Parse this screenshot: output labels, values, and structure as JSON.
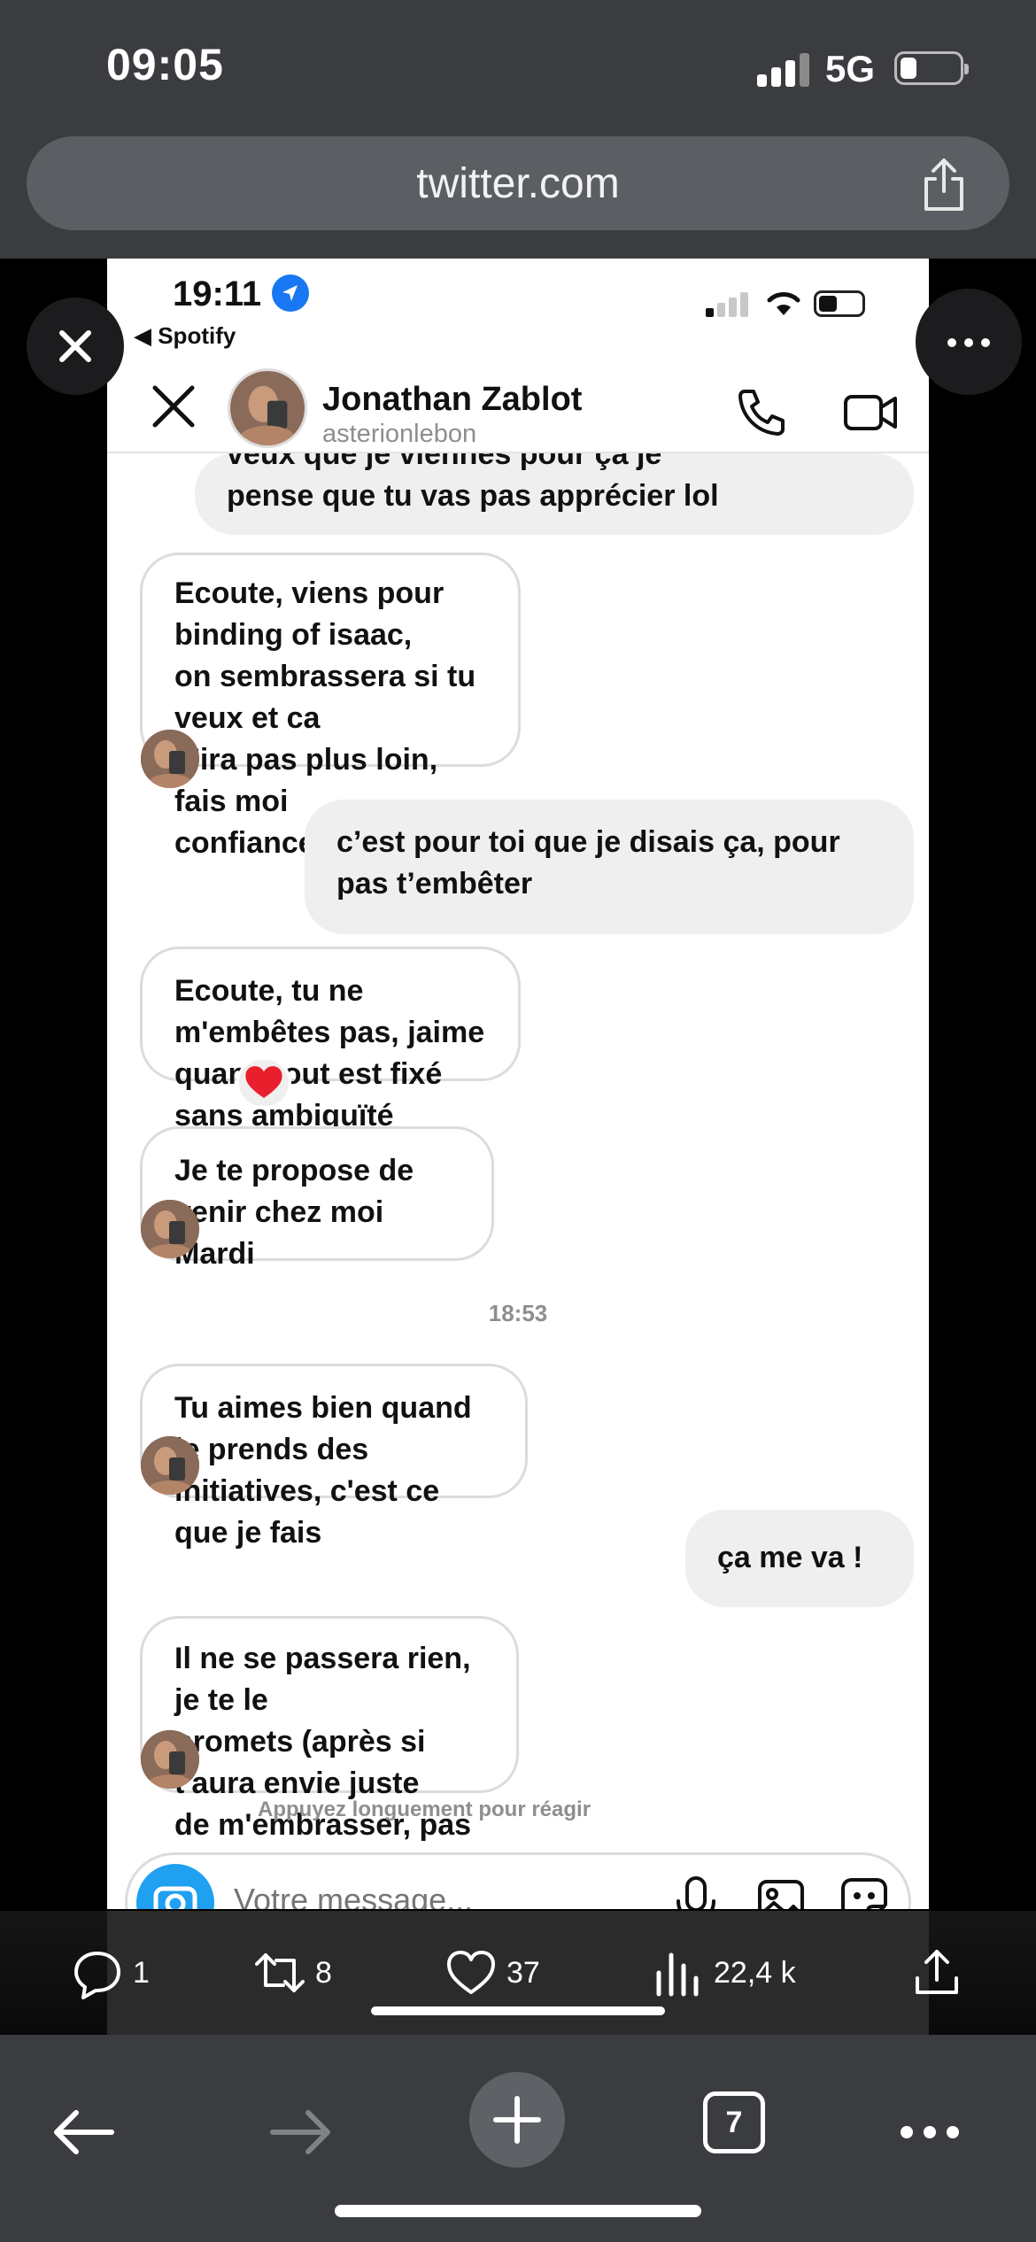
{
  "status_bar": {
    "time": "09:05",
    "network": "5G"
  },
  "url_bar": {
    "url": "twitter.com"
  },
  "embedded": {
    "status": {
      "time": "19:11",
      "back_app": "◀ Spotify"
    },
    "header": {
      "name": "Jonathan Zablot",
      "handle": "asterionlebon"
    },
    "messages": [
      {
        "side": "out",
        "lines": [
          "veux que je viennes pour ça je",
          "pense que tu vas pas apprécier lol"
        ]
      },
      {
        "side": "in",
        "lines": [
          "Ecoute, viens pour binding of isaac,",
          "on sembrassera si tu veux et ca",
          "n'ira pas plus loin, fais moi",
          "confiance"
        ]
      },
      {
        "side": "out",
        "lines": [
          "c’est pour toi que je disais ça, pour",
          "pas t’embêter"
        ]
      },
      {
        "side": "in",
        "lines": [
          "Ecoute, tu ne m'embêtes pas, jaime",
          "quand tout est fixé sans ambiguïté"
        ],
        "reaction": "❤️"
      },
      {
        "side": "in",
        "lines": [
          "Je te propose de venir chez moi",
          "Mardi"
        ]
      },
      {
        "side": "in",
        "lines": [
          "Tu aimes bien quand je prends des",
          "initiatives, c'est ce que je fais"
        ]
      },
      {
        "side": "out",
        "lines": [
          "ça me va !"
        ]
      },
      {
        "side": "in",
        "lines": [
          "Il ne se passera rien, je te le",
          "promets (après si t'aura envie juste",
          "de m'embrasser, pas de souci)"
        ]
      }
    ],
    "timestamp": "18:53",
    "hint": "Appuyez longuement pour réagir",
    "composer": {
      "placeholder": "Votre message..."
    }
  },
  "tweet_actions": {
    "replies": "1",
    "retweets": "8",
    "likes": "37",
    "views": "22,4 k"
  },
  "toolbar": {
    "tab_count": "7"
  },
  "colors": {
    "chrome": "#3a3c3f",
    "url_bar": "#5b5e62",
    "instagram_blue": "#1877f2",
    "bubble_out": "#efefef",
    "bubble_border": "#dcdcdc"
  }
}
